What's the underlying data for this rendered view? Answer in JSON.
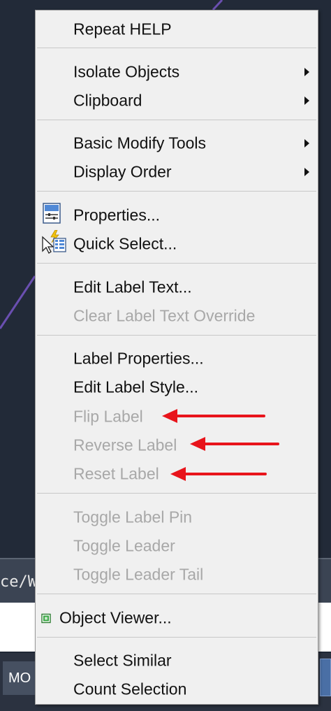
{
  "command_line": {
    "text": "ce/W"
  },
  "status_bar": {
    "model_tab": "MO"
  },
  "menu": {
    "items": [
      {
        "label": "Repeat HELP",
        "enabled": true
      },
      {
        "label": "Isolate Objects",
        "enabled": true,
        "submenu": true
      },
      {
        "label": "Clipboard",
        "enabled": true,
        "submenu": true
      },
      {
        "label": "Basic Modify Tools",
        "enabled": true,
        "submenu": true
      },
      {
        "label": "Display Order",
        "enabled": true,
        "submenu": true
      },
      {
        "label": "Properties...",
        "enabled": true,
        "icon": "properties-icon"
      },
      {
        "label": "Quick Select...",
        "enabled": true,
        "icon": "quick-select-icon"
      },
      {
        "label": "Edit Label Text...",
        "enabled": true
      },
      {
        "label": "Clear Label Text Override",
        "enabled": false
      },
      {
        "label": "Label Properties...",
        "enabled": true
      },
      {
        "label": "Edit Label Style...",
        "enabled": true
      },
      {
        "label": "Flip Label",
        "enabled": false
      },
      {
        "label": "Reverse Label",
        "enabled": false
      },
      {
        "label": "Reset Label",
        "enabled": false
      },
      {
        "label": "Toggle Label Pin",
        "enabled": false
      },
      {
        "label": "Toggle Leader",
        "enabled": false
      },
      {
        "label": "Toggle Leader Tail",
        "enabled": false
      },
      {
        "label": "Object Viewer...",
        "enabled": true,
        "icon": "object-viewer-icon"
      },
      {
        "label": "Select Similar",
        "enabled": true
      },
      {
        "label": "Count Selection",
        "enabled": true
      }
    ]
  },
  "annotations": {
    "arrow_color": "#e8141b"
  },
  "colors": {
    "menu_bg": "#f0f0f0",
    "enabled_text": "#111111",
    "disabled_text": "#a8a8a8",
    "app_bg": "#222a38"
  }
}
